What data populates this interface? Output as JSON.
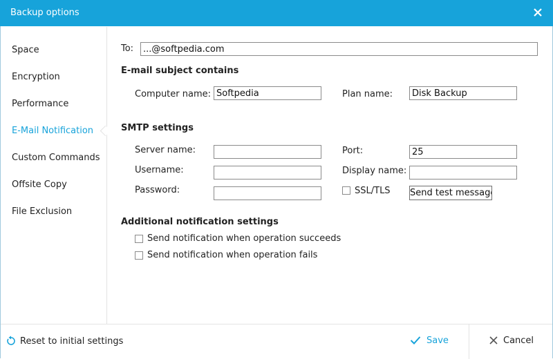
{
  "window": {
    "title": "Backup options"
  },
  "colors": {
    "accent": "#17a3da"
  },
  "sidebar": {
    "items": [
      {
        "label": "Space"
      },
      {
        "label": "Encryption"
      },
      {
        "label": "Performance"
      },
      {
        "label": "E-Mail Notification",
        "active": true
      },
      {
        "label": "Custom Commands"
      },
      {
        "label": "Offsite Copy"
      },
      {
        "label": "File Exclusion"
      }
    ]
  },
  "email": {
    "to_label": "To:",
    "to_value": "...@softpedia.com",
    "subject_heading": "E-mail subject contains",
    "computer_name_label": "Computer name:",
    "computer_name_value": "Softpedia",
    "plan_name_label": "Plan name:",
    "plan_name_value": "Disk Backup"
  },
  "smtp": {
    "heading": "SMTP settings",
    "server_label": "Server name:",
    "server_value": "",
    "port_label": "Port:",
    "port_value": "25",
    "username_label": "Username:",
    "username_value": "",
    "display_name_label": "Display name:",
    "display_name_value": "",
    "password_label": "Password:",
    "password_value": "",
    "ssl_label": "SSL/TLS",
    "ssl_checked": false,
    "test_button": "Send test message"
  },
  "additional": {
    "heading": "Additional notification settings",
    "on_success_label": "Send notification when operation succeeds",
    "on_success_checked": false,
    "on_fail_label": "Send notification when operation fails",
    "on_fail_checked": false
  },
  "footer": {
    "reset_label": "Reset to initial settings",
    "save_label": "Save",
    "cancel_label": "Cancel"
  },
  "icons": {
    "close": "close-icon",
    "reset": "reset-icon",
    "save": "checkmark-icon",
    "cancel": "cross-icon"
  }
}
